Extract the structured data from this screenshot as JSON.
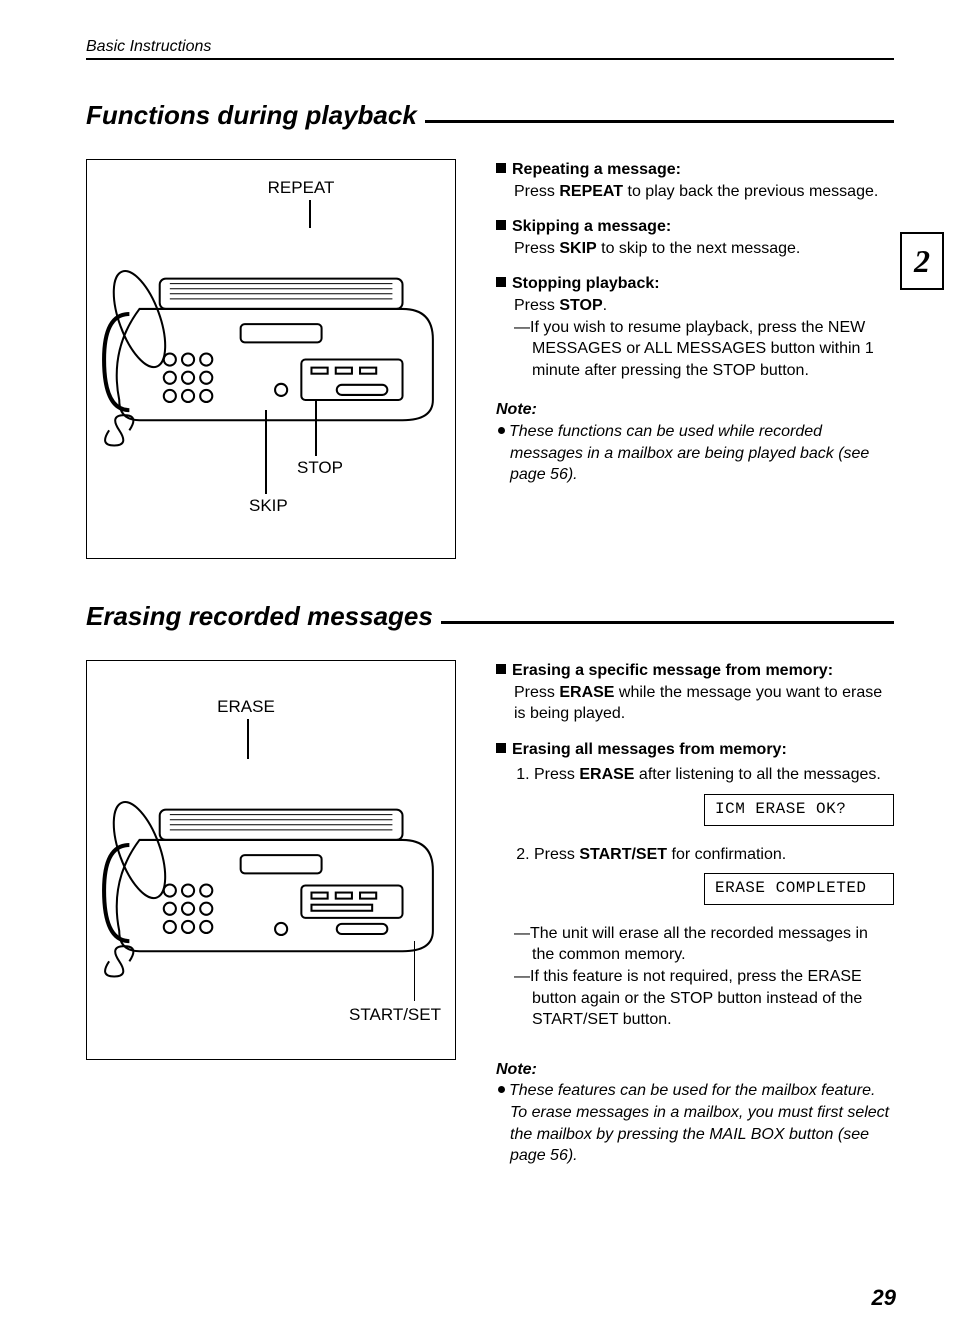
{
  "header": "Basic Instructions",
  "chapter_tab": "2",
  "page_number": "29",
  "section1": {
    "title": "Functions during playback",
    "fig_labels": {
      "repeat": "REPEAT",
      "stop": "STOP",
      "skip": "SKIP"
    },
    "items": {
      "repeat_head": "Repeating a message:",
      "repeat_body_pre": "Press ",
      "repeat_key": "REPEAT",
      "repeat_body_post": " to play back the previous message.",
      "skip_head": "Skipping a message:",
      "skip_body_pre": "Press ",
      "skip_key": "SKIP",
      "skip_body_post": " to skip to the next message.",
      "stop_head": "Stopping playback:",
      "stop_body_pre": "Press ",
      "stop_key": "STOP",
      "stop_body_post": ".",
      "stop_sub": "—If you wish to resume playback, press the NEW MESSAGES or ALL MESSAGES button within 1 minute after pressing the STOP button."
    },
    "note_head": "Note:",
    "note_body": "These functions can be used while recorded messages in a mailbox are being played back (see page 56)."
  },
  "section2": {
    "title": "Erasing recorded messages",
    "fig_labels": {
      "erase": "ERASE",
      "startset": "START/SET"
    },
    "items": {
      "a_head": "Erasing a specific message from memory:",
      "a_body_pre": "Press ",
      "a_key": "ERASE",
      "a_body_post": " while the message you want to erase is being played.",
      "b_head": "Erasing all messages from memory:",
      "b_step1_pre": "Press ",
      "b_step1_key": "ERASE",
      "b_step1_post": " after listening to all the messages.",
      "lcd1": "ICM ERASE OK?",
      "b_step2_pre": "Press ",
      "b_step2_key": "START/SET",
      "b_step2_post": " for confirmation.",
      "lcd2": "ERASE COMPLETED",
      "b_sub1": "—The unit will erase all the recorded messages in the common memory.",
      "b_sub2": "—If this feature is not required, press the ERASE button again or the STOP button instead of the START/SET button."
    },
    "note_head": "Note:",
    "note_body": "These features can be used for the mailbox feature. To erase messages in a mailbox, you must first select the mailbox by pressing the MAIL BOX button (see page 56)."
  }
}
